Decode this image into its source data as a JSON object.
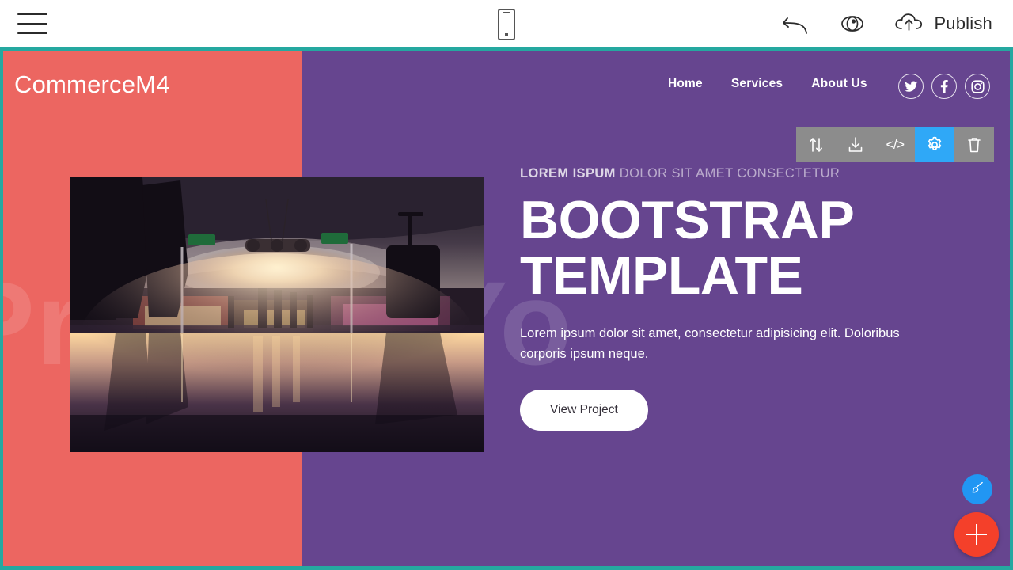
{
  "editor": {
    "menu_icon": "hamburger-menu-icon",
    "device_icon": "mobile-device-icon",
    "undo_icon": "undo-arrow-icon",
    "preview_icon": "eye-preview-icon",
    "publish_icon": "cloud-upload-icon",
    "publish_label": "Publish"
  },
  "block_toolbar": {
    "items": [
      {
        "name": "move-block",
        "icon": "up-down-arrows-icon",
        "active": false
      },
      {
        "name": "download-block",
        "icon": "download-icon",
        "active": false
      },
      {
        "name": "edit-code-block",
        "icon": "code-brackets-icon",
        "label": "</>",
        "active": false
      },
      {
        "name": "block-settings",
        "icon": "gear-icon",
        "active": true
      },
      {
        "name": "delete-block",
        "icon": "trash-icon",
        "active": false
      }
    ]
  },
  "site": {
    "brand": "CommerceM4",
    "nav": [
      {
        "label": "Home"
      },
      {
        "label": "Services"
      },
      {
        "label": "About Us"
      }
    ],
    "socials": [
      {
        "name": "twitter-icon"
      },
      {
        "name": "facebook-icon"
      },
      {
        "name": "instagram-icon"
      }
    ]
  },
  "hero": {
    "watermark": "Present Yo",
    "kicker_bold": "LOREM ISPUM",
    "kicker_rest": " DOLOR SIT AMET CONSECTETUR",
    "title": "BOOTSTRAP TEMPLATE",
    "text": "Lorem ipsum dolor sit amet, consectetur adipisicing elit. Doloribus corporis ipsum neque.",
    "button_label": "View Project",
    "photo_alt": "airport-terminal-shopping-concourse-photo"
  },
  "floating": {
    "brush_icon": "paintbrush-icon",
    "add_icon": "plus-icon"
  },
  "colors": {
    "coral": "#ec6661",
    "purple": "#66458f",
    "teal_border": "#25a8a0",
    "accent_blue": "#2fa8f7",
    "fab_red": "#f4402a",
    "toolbar_gray": "#8c8c8c"
  }
}
